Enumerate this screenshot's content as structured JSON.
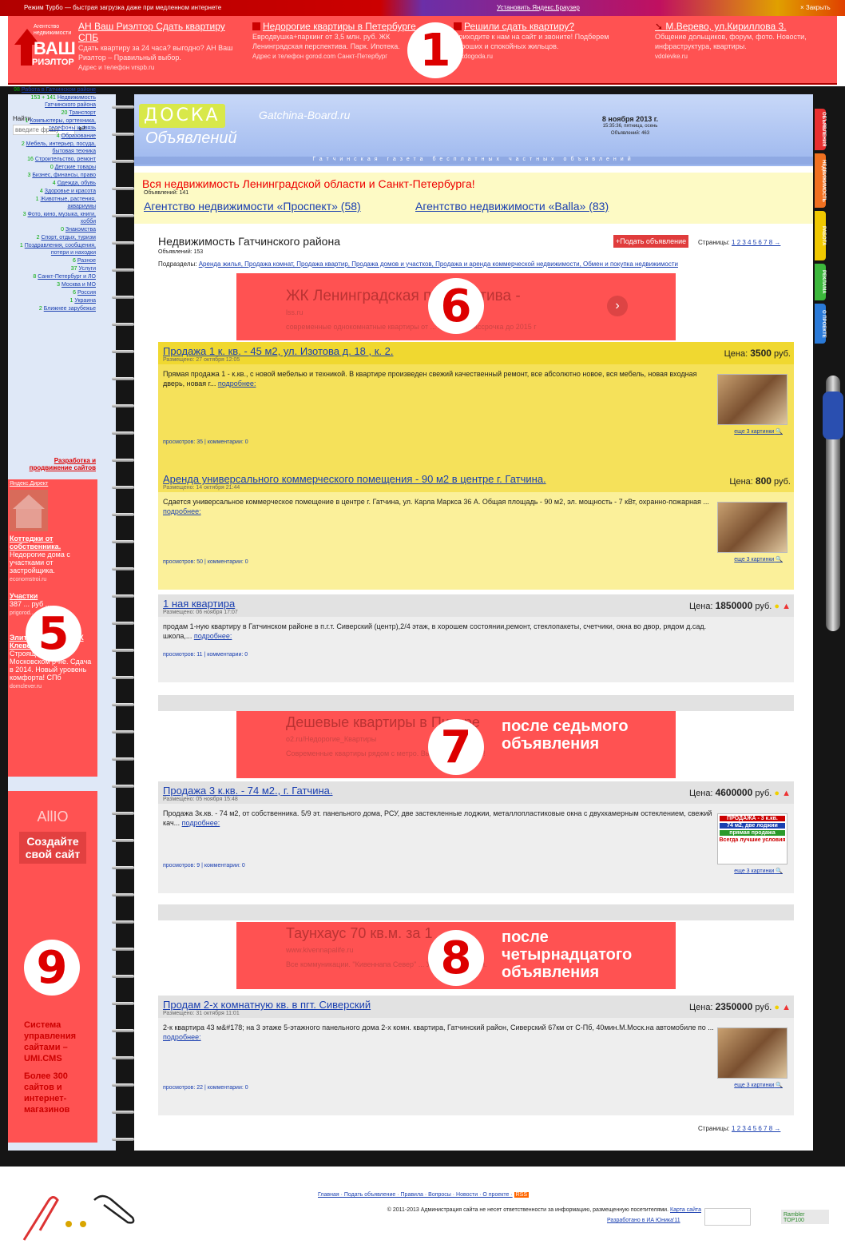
{
  "turbo": {
    "text": "Режим Турбо — быстрая загрузка даже при медленном интернете",
    "install": "Установить Яндекс.Браузер",
    "close": "× Закрыть"
  },
  "top_ads": [
    {
      "title": "АН Ваш Риэлтор Сдать квартиру СПБ",
      "desc": "Сдать квартиру за 24 часа? выгодно? АН Ваш Риэлтор – Правильный выбор.",
      "src": "Адрес и телефон  vrspb.ru"
    },
    {
      "title": "Недорогие квартиры в Петербурге",
      "desc": "Евродвушка+паркинг от 3,5 млн. руб. ЖК Ленинградская перспектива. Парк. Ипотека.",
      "src": "Адрес и телефон  gorod.com Санкт-Петербург"
    },
    {
      "title": "Решили сдать квартиру?",
      "desc": "Приходите к нам на сайт и звоните! Подберем хороших и спокойных жильцов.",
      "src": "dokdogoda.ru"
    },
    {
      "title": "М.Верево, ул.Кириллова 3.",
      "desc": "Общение дольщиков, форум, фото. Новости, инфраструктура, квартиры.",
      "src": "vdolevke.ru"
    }
  ],
  "vash_logo": {
    "line1": "Агентство недвижимости",
    "line2": "ВАШ",
    "line3": "РИЭЛТОР"
  },
  "markers": [
    "1",
    "5",
    "6",
    "7",
    "8",
    "9"
  ],
  "notes": {
    "n7": "после седьмого объявления",
    "n8": "после четырнадцатого объявления"
  },
  "search": {
    "label": "Найти",
    "placeholder": "введите фразу",
    "go": "↵"
  },
  "header": {
    "logo1": "ДОСКА",
    "logo2": "Объявлений",
    "site": "Gatchina-Board.ru",
    "date": "8 ноября 2013 г.",
    "time": "15:35:36, пятница, осень",
    "count": "Объявлений: 463",
    "tagline": "Гатчинская газета бесплатных частных объявлений"
  },
  "nav": [
    {
      "c": "98",
      "t": "Работа в Гатчинском районе"
    },
    {
      "c": "153 + 141",
      "t": "Недвижимость Гатчинского района"
    },
    {
      "c": "20",
      "t": "Транспорт"
    },
    {
      "c": "1",
      "t": "Компьютеры, оргтехника, телефоны и связь"
    },
    {
      "c": "4",
      "t": "Образование"
    },
    {
      "c": "2",
      "t": "Мебель, интерьер, посуда, бытовая техника"
    },
    {
      "c": "16",
      "t": "Строительство, ремонт"
    },
    {
      "c": "0",
      "t": "Детские товары"
    },
    {
      "c": "3",
      "t": "Бизнес, финансы, право"
    },
    {
      "c": "4",
      "t": "Одежда, обувь"
    },
    {
      "c": "4",
      "t": "Здоровье и красота"
    },
    {
      "c": "1",
      "t": "Животные, растения, аквариумы"
    },
    {
      "c": "3",
      "t": "Фото, кино, музыка, книги, хобби"
    },
    {
      "c": "0",
      "t": "Знакомства"
    },
    {
      "c": "2",
      "t": "Спорт, отдых, туризм"
    },
    {
      "c": "1",
      "t": "Поздравления, сообщения, потери и находки"
    },
    {
      "c": "6",
      "t": "Разное"
    },
    {
      "c": "37",
      "t": "Услуги"
    },
    {
      "c": "8",
      "t": "Санкт-Петербург и ЛО"
    },
    {
      "c": "3",
      "t": "Москва и МО"
    },
    {
      "c": "6",
      "t": "Россия"
    },
    {
      "c": "1",
      "t": "Украина"
    },
    {
      "c": "2",
      "t": "Ближнее зарубежье"
    }
  ],
  "devlink": "Разработка и продвижение сайтов",
  "side_ads": {
    "direct": "Яндекс.Директ",
    "a1t": "Коттеджи от собственника.",
    "a1d": "Недорогие дома с участками от застройщика.",
    "a1s": "economstroi.ru",
    "a2t": "Участки",
    "a2d": "387 ... руб ...",
    "a2s": "prigorod...",
    "a3t": "Элитное жилье в ЖК Клевер",
    "a3d": "Строящийся ЖК в Московском р-не. Сдача в 2014. Новый уровень комфорта! СПб",
    "a3s": "domclever.ru"
  },
  "side_ads2": {
    "brand": "AllIO",
    "create": "Создайте свой сайт",
    "sys": "Система управления сайтами – UMI.CMS",
    "more": "Более 300 сайтов и интернет-магазинов"
  },
  "promo": {
    "title": "Вся недвижимость Ленинградской области и Санкт-Петербурга!",
    "count": "Объявлений: 141",
    "link1": "Агентство недвижимости «Проспект» (58)",
    "link2": "Агентство недвижимости «Balla» (83)"
  },
  "section": {
    "title": "Недвижимость Гатчинского района",
    "count": "Объявлений: 153",
    "sub_label": "Подразделы:",
    "subs": "Аренда жилья, Продажа комнат, Продажа квартир, Продажа домов и участков, Продажа и аренда коммерческой недвижимости, Обмен и покупка недвижимости",
    "add": "+Подать объявление",
    "pages_label": "Страницы:",
    "pages": "1 2 3 4 5 6 7 8 →"
  },
  "ads_in": [
    {
      "title": "ЖК Ленинградская перспектива -",
      "src": "lss.ru",
      "desc": "современные однокомнатные квартиры от ... млн.руб. Рассрочка до 2015 г"
    },
    {
      "title": "Дешевые квартиры в Питере",
      "src": "o2.ru/Недорогие_Квартиры",
      "desc": "Современные квартиры рядом с метро. Выгодные условия!"
    },
    {
      "title": "Таунхаус 70 кв.м. за 1 ... р",
      "src": "www.kivennapalife.ru",
      "desc": "Все коммуникации. \"Кивеннапа Север\" ... Удобные условия."
    }
  ],
  "listings": [
    {
      "title": "Продажа 1 к. кв. - 45 м2, ул. Изотова д. 18 , к. 2.",
      "date": "Размещено: 27 октября 12:05",
      "price_label": "Цена:",
      "price": "3500",
      "cur": "руб.",
      "text": "Прямая продажа 1 - к.кв., с новой мебелью и техникой. В квартире произведен свежий качественный ремонт, все абсолютно новое, вся мебель, новая входная дверь, новая г... ",
      "more": "подробнее:",
      "stat": "просмотров: 35 | комментарии: 0",
      "pics": "еще 3 картинки"
    },
    {
      "title": "Аренда универсального коммерческого помещения - 90 м2 в центре г. Гатчина.",
      "date": "Размещено: 14 октября 21:44",
      "price_label": "Цена:",
      "price": "800",
      "cur": "руб.",
      "text": "Сдается универсальное коммерческое помещение в центре г. Гатчина, ул. Карла Маркса 36 А. Общая площадь - 90 м2, эл. мощность - 7 кВт, охранно-пожарная ... ",
      "more": "подробнее:",
      "stat": "просмотров: 50 | комментарии: 0",
      "pics": "еще 3 картинки"
    },
    {
      "title": "1 ная квартира",
      "date": "Размещено: 06 ноября 17:07",
      "price_label": "Цена:",
      "price": "1850000",
      "cur": "руб.",
      "text": "продам 1-ную квартиру в Гатчинском районе в п.г.т. Сиверский (центр),2/4 этаж, в хорошем состоянии,ремонт, стеклопакеты, счетчики, окна во двор, рядом д.сад. школа,... ",
      "more": "подробнее:",
      "stat": "просмотров: 11 | комментарии: 0",
      "pics": ""
    },
    {
      "title": "Продажа 3 к.кв. - 74 м2., г. Гатчина.",
      "date": "Размещено: 05 ноября 15:48",
      "price_label": "Цена:",
      "price": "4600000",
      "cur": "руб.",
      "text": "Продажа 3к.кв. - 74 м2, от собственника. 5/9 эт. панельного дома, РСУ, две застекленные лоджии, металлопластиковые окна с двухкамерным остеклением, свежий кач... ",
      "more": "подробнее:",
      "stat": "просмотров: 9 | комментарии: 0",
      "pics": "еще 3 картинки"
    },
    {
      "title": "Продам 2-х комнатную кв. в пгт. Сиверский",
      "date": "Размещено: 31 октября 11:01",
      "price_label": "Цена:",
      "price": "2350000",
      "cur": "руб.",
      "text": "2-к квартира 43 м&#178; на 3 этаже 5-этажного панельного дома 2-х комн. квартира, Гатчинский район, Сиверский 67км от С-Пб, 40мин.М.Моск.на автомобиле по ... ",
      "more": "подробнее:",
      "stat": "просмотров: 22 | комментарии: 0",
      "pics": "еще 3 картинки"
    }
  ],
  "thumb3": {
    "l1": "ПРОДАЖА - 3 к.кв.",
    "l2": "74 м2, две лоджии",
    "l3": "прямая продажа",
    "l4": "Всегда лучшие условия"
  },
  "tabs": [
    "ОБЪЯВЛЕНИЯ",
    "НЕДВИЖИМОСТЬ",
    "РАБОТА",
    "РЕКЛАМА",
    "О ПРОЕКТЕ"
  ],
  "footer": {
    "links": "Главная · Подать объявление · Правила · Вопросы · Новости · О проекте ·",
    "rss": "RSS",
    "copy": "© 2011-2013 Администрация сайта не несет ответственности за информацию, размещенную посетителями.",
    "map": "Карта сайта",
    "dev": "Разработано в ИА Юника'11",
    "rambler": "Rambler TOP100"
  },
  "colors": {
    "ad_red": "#ff5252",
    "yellow": "#f5e15a",
    "blue_bg": "#dfe8f7"
  }
}
